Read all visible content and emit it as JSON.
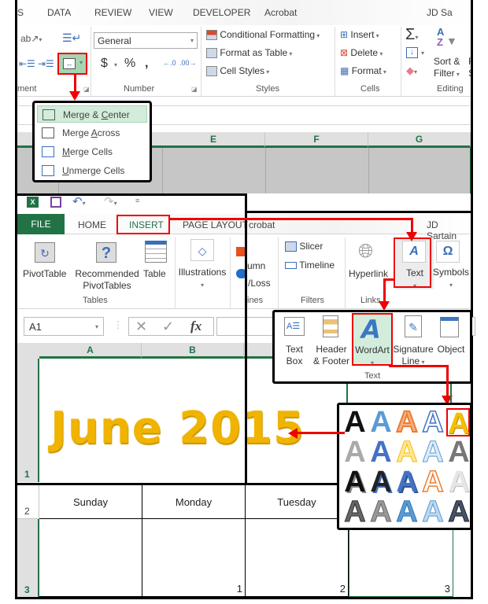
{
  "top_window": {
    "tabs": [
      "S",
      "DATA",
      "REVIEW",
      "VIEW",
      "DEVELOPER",
      "Acrobat"
    ],
    "user": "JD Sa",
    "alignment_group_label": "ment",
    "number_format": "General",
    "number_buttons": [
      "$",
      "%",
      ","
    ],
    "number_group_label": "Number",
    "styles": {
      "conditional_formatting": "Conditional Formatting",
      "format_as_table": "Format as Table",
      "cell_styles": "Cell Styles",
      "group_label": "Styles"
    },
    "cells": {
      "insert": "Insert",
      "delete": "Delete",
      "format": "Format",
      "group_label": "Cells"
    },
    "editing": {
      "sort_filter_line1": "Sort &",
      "sort_filter_line2": "Filter",
      "find_line1": "F",
      "find_line2": "S",
      "group_label": "Editing"
    },
    "column_headers": [
      "E",
      "F",
      "G"
    ]
  },
  "merge_menu": {
    "items": [
      {
        "pre": "Merge & ",
        "ul": "C",
        "post": "enter",
        "selected": true
      },
      {
        "pre": "Merge ",
        "ul": "A",
        "post": "cross",
        "selected": false
      },
      {
        "pre": "",
        "ul": "M",
        "post": "erge Cells",
        "selected": false
      },
      {
        "pre": "",
        "ul": "U",
        "post": "nmerge Cells",
        "selected": false
      }
    ]
  },
  "second_window": {
    "tabs": {
      "file": "FILE",
      "home": "HOME",
      "insert": "INSERT",
      "page_layout": "PAGE LAYOUT",
      "acrobat": "crobat"
    },
    "user": "JD Sartain",
    "tables": {
      "pivottable": "PivotTable",
      "recommended_line1": "Recommended",
      "recommended_line2": "PivotTables",
      "table": "Table",
      "group_label": "Tables"
    },
    "illustrations": "Illustrations",
    "sparklines_partial": {
      "column": "umn",
      "winloss": "/Loss",
      "group": "ines"
    },
    "filters": {
      "slicer": "Slicer",
      "timeline": "Timeline",
      "group_label": "Filters"
    },
    "links": {
      "hyperlink": "Hyperlink",
      "group_label": "Links"
    },
    "text_button": "Text",
    "symbols_button": "Symbols",
    "name_box": "A1",
    "fx": "fx",
    "column_headers": [
      "A",
      "B"
    ]
  },
  "text_group": {
    "text_box_line1": "Text",
    "text_box_line2": "Box",
    "header_line1": "Header",
    "header_line2": "& Footer",
    "wordart": "WordArt",
    "signature_line1": "Signature",
    "signature_line2": "Line",
    "object": "Object",
    "group_label": "Text"
  },
  "wordart_gallery": {
    "glyph": "A",
    "selected_index": 4,
    "rows": 4,
    "cols": 5
  },
  "sheet": {
    "title": "June 2015",
    "title_color": "#f0b400",
    "row_numbers": [
      "1",
      "2",
      "3"
    ],
    "day_headers": [
      "Sunday",
      "Monday",
      "Tuesday"
    ],
    "day_numbers": [
      "",
      "1",
      "2",
      "3"
    ]
  },
  "colors": {
    "excel_green": "#217346",
    "highlight_red": "#e00000",
    "selected_green": "#a6d5b4"
  }
}
